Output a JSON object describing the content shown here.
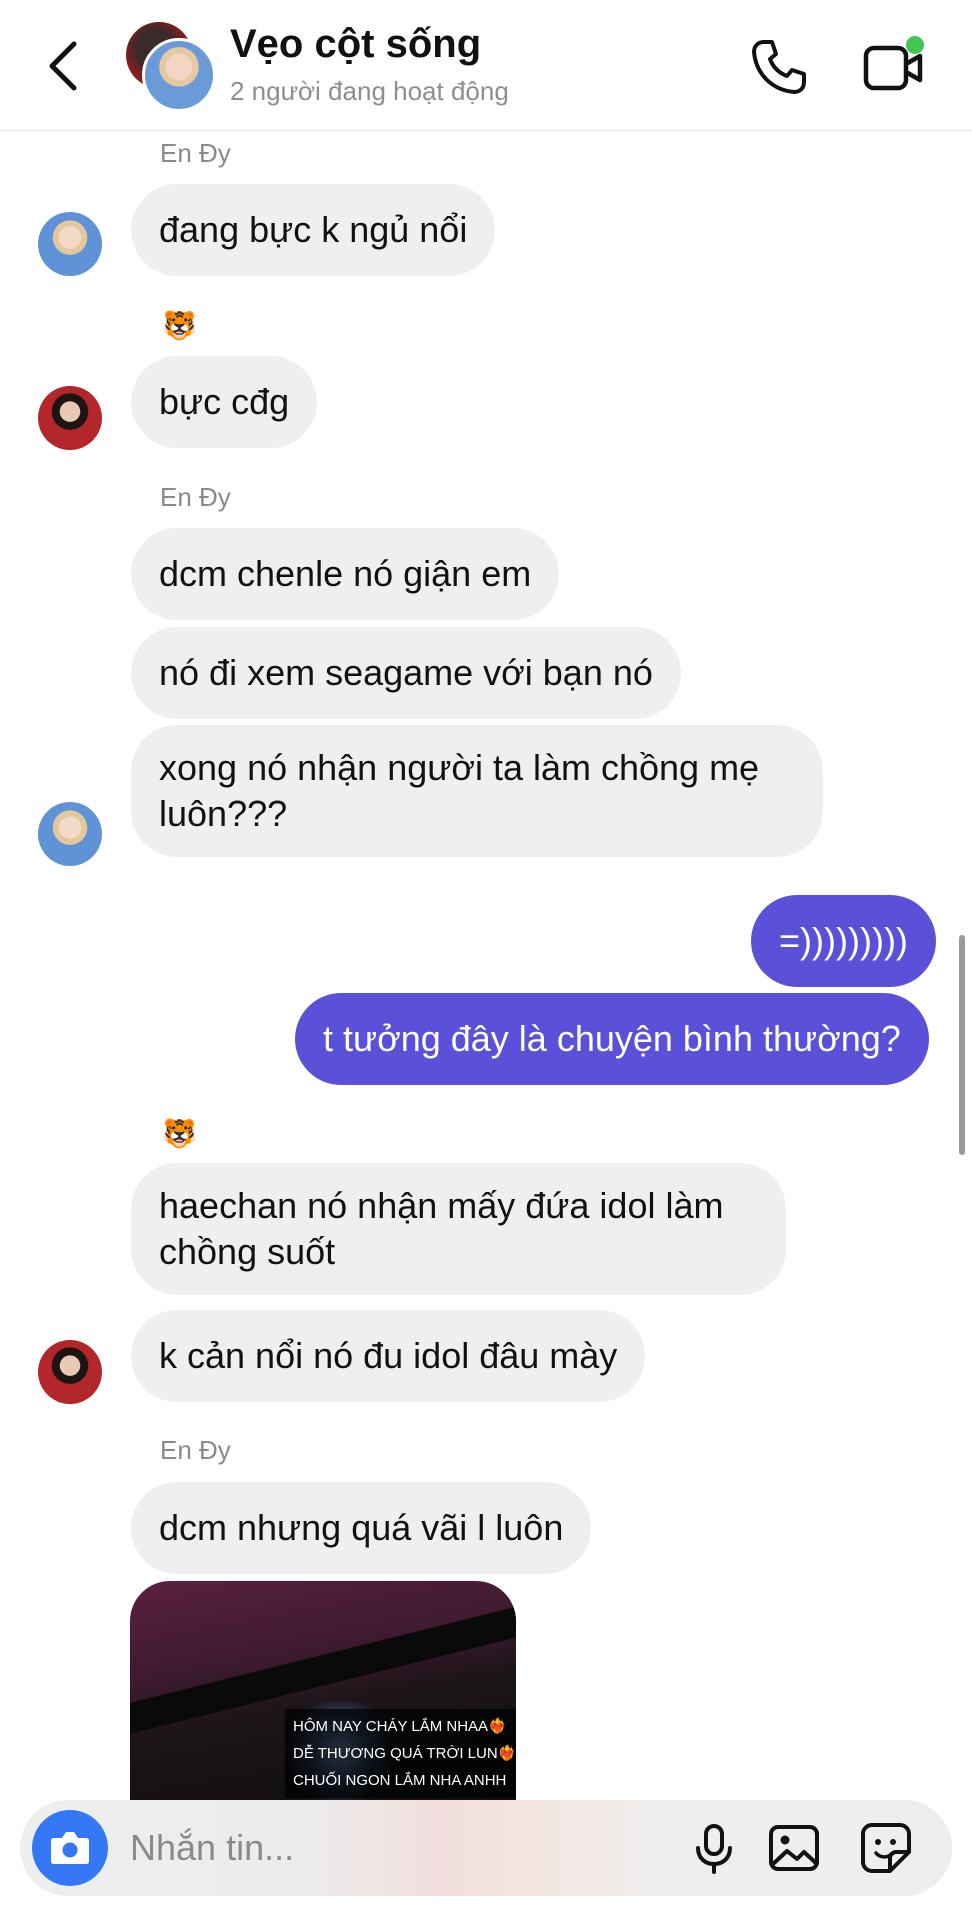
{
  "header": {
    "title": "Vẹo cột sống",
    "subtitle": "2 người đang hoạt động"
  },
  "messages": [
    {
      "type": "label",
      "text": "En Đy"
    },
    {
      "type": "recv",
      "text": "đang bực k ngủ nổi"
    },
    {
      "type": "reaction",
      "emoji": "🐯"
    },
    {
      "type": "recv",
      "text": "bực cđg"
    },
    {
      "type": "label",
      "text": "En Đy"
    },
    {
      "type": "recv",
      "text": "dcm chenle nó giận em"
    },
    {
      "type": "recv",
      "text": "nó đi xem seagame với bạn nó"
    },
    {
      "type": "recv",
      "text": "xong nó nhận người ta làm chồng mẹ luôn???"
    },
    {
      "type": "sent",
      "text": "=)))))))))"
    },
    {
      "type": "sent",
      "text": "t tưởng đây là chuyện bình thường?"
    },
    {
      "type": "reaction",
      "emoji": "🐯"
    },
    {
      "type": "recv",
      "text": "haechan nó nhận mấy đứa idol làm chồng suốt"
    },
    {
      "type": "recv",
      "text": "k cản nổi nó đu idol đâu mày"
    },
    {
      "type": "label",
      "text": "En Đy"
    },
    {
      "type": "recv",
      "text": "dcm nhưng quá vãi l luôn"
    }
  ],
  "photo_caption": [
    "HÔM NAY CHÁY LẮM NHAA❤️‍🔥",
    "DỄ THƯƠNG QUÁ TRỜI LUN❤️‍🔥",
    "CHUỐI NGON LẮM NHA ANHH"
  ],
  "composer": {
    "placeholder": "Nhắn tin..."
  },
  "colors": {
    "sent_bubble": "#5b51d8",
    "recv_bubble": "#efefef",
    "online": "#44c552",
    "camera": "#3478f6"
  },
  "icons": [
    "back-icon",
    "phone-icon",
    "video-call-icon",
    "camera-icon",
    "microphone-icon",
    "gallery-icon",
    "sticker-icon"
  ]
}
